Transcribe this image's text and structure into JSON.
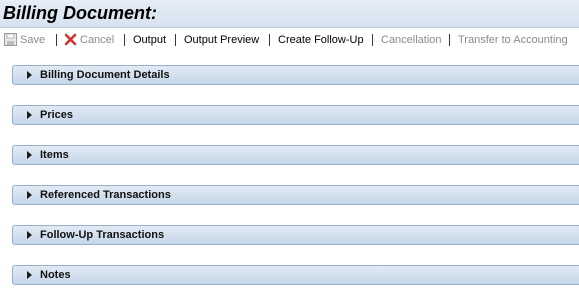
{
  "window": {
    "title": "Billing Document:"
  },
  "toolbar": {
    "save_label": "Save",
    "cancel_label": "Cancel",
    "output_label": "Output",
    "output_preview_label": "Output Preview",
    "create_follow_up_label": "Create Follow-Up",
    "cancellation_label": "Cancellation",
    "transfer_label": "Transfer to Accounting"
  },
  "sections": [
    {
      "label": "Billing Document Details",
      "expanded": false
    },
    {
      "label": "Prices",
      "expanded": false
    },
    {
      "label": "Items",
      "expanded": false
    },
    {
      "label": "Referenced Transactions",
      "expanded": false
    },
    {
      "label": "Follow-Up Transactions",
      "expanded": false
    },
    {
      "label": "Notes",
      "expanded": false
    }
  ],
  "colors": {
    "title_bar": "#dce6f1",
    "panel_header": "#c6d6e7",
    "disabled_text": "#8a8a8a",
    "cancel_icon": "#d0352b"
  }
}
